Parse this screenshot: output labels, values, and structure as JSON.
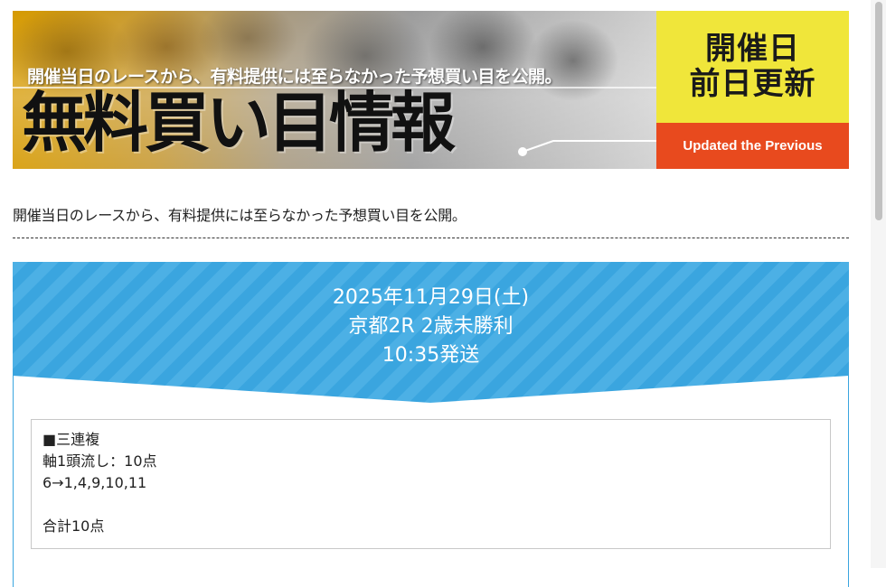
{
  "banner": {
    "subtitle": "開催当日のレースから、有料提供には至らなかった予想買い目を公開。",
    "title": "無料買い目情報",
    "badge_line1": "開催日",
    "badge_line2": "前日更新",
    "badge_en": "Updated the Previous"
  },
  "intro": {
    "text": "開催当日のレースから、有料提供には至らなかった予想買い目を公開。"
  },
  "race": {
    "date": "2025年11月29日(土)",
    "name": "京都2R 2歳未勝利",
    "post_time": "10:35発送"
  },
  "bet": {
    "type": "■三連複",
    "method": "軸1頭流し：10点",
    "combination": "6→1,4,9,10,11",
    "total": "合計10点"
  },
  "colors": {
    "header_blue": "#3aa5df",
    "badge_yellow": "#f0e63a",
    "badge_red": "#e84a1e"
  }
}
